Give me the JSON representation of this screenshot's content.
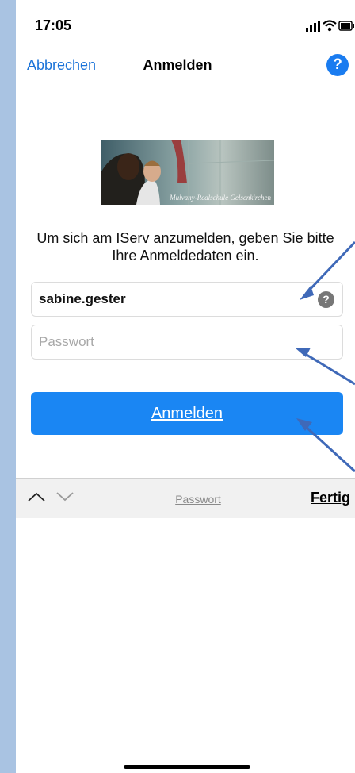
{
  "status": {
    "time": "17:05"
  },
  "nav": {
    "cancel": "Abbrechen",
    "title": "Anmelden",
    "help": "?"
  },
  "logo": {
    "caption": "Mulvany-Realschule Gelsenkirchen"
  },
  "intro": "Um sich am IServ anzumelden, geben Sie bitte Ihre Anmeldedaten ein.",
  "form": {
    "username_value": "sabine.gester",
    "username_help": "?",
    "password_placeholder": "Passwort",
    "submit": "Anmelden"
  },
  "keyboard_toolbar": {
    "field_label": "Passwort",
    "done": "Fertig"
  },
  "colors": {
    "accent": "#1a86f3",
    "page_background": "#a9c3e2"
  }
}
